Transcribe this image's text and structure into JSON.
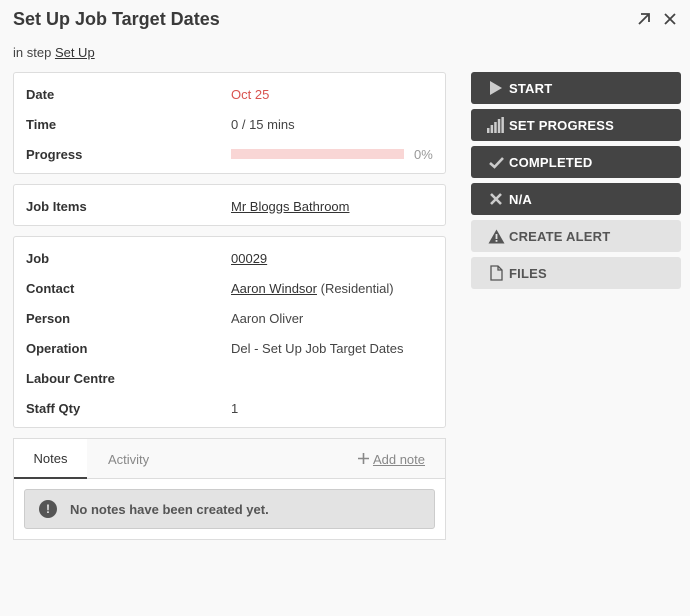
{
  "header": {
    "title": "Set Up Job Target Dates",
    "step_prefix": "in step",
    "step_link": "Set Up"
  },
  "schedule": {
    "date_label": "Date",
    "date_value": "Oct 25",
    "time_label": "Time",
    "time_value": "0 / 15 mins",
    "progress_label": "Progress",
    "progress_value": "0%",
    "progress_fraction": 0
  },
  "job_items": {
    "label": "Job Items",
    "value": "Mr Bloggs Bathroom"
  },
  "details": {
    "job_label": "Job",
    "job_value": "00029",
    "contact_label": "Contact",
    "contact_link": "Aaron Windsor",
    "contact_suffix": "(Residential)",
    "person_label": "Person",
    "person_value": "Aaron Oliver",
    "operation_label": "Operation",
    "operation_value": "Del - Set Up Job Target Dates",
    "labour_label": "Labour Centre",
    "labour_value": "",
    "staff_label": "Staff Qty",
    "staff_value": "1"
  },
  "actions": {
    "start": "START",
    "set_progress": "SET PROGRESS",
    "completed": "COMPLETED",
    "na": "N/A",
    "create_alert": "CREATE ALERT",
    "files": "FILES"
  },
  "tabs": {
    "notes": "Notes",
    "activity": "Activity",
    "add_note": "Add note",
    "empty_message": "No notes have been created yet."
  },
  "colors": {
    "accent_red": "#d9534f",
    "dark_button": "#444444",
    "light_button": "#e3e3e3"
  }
}
